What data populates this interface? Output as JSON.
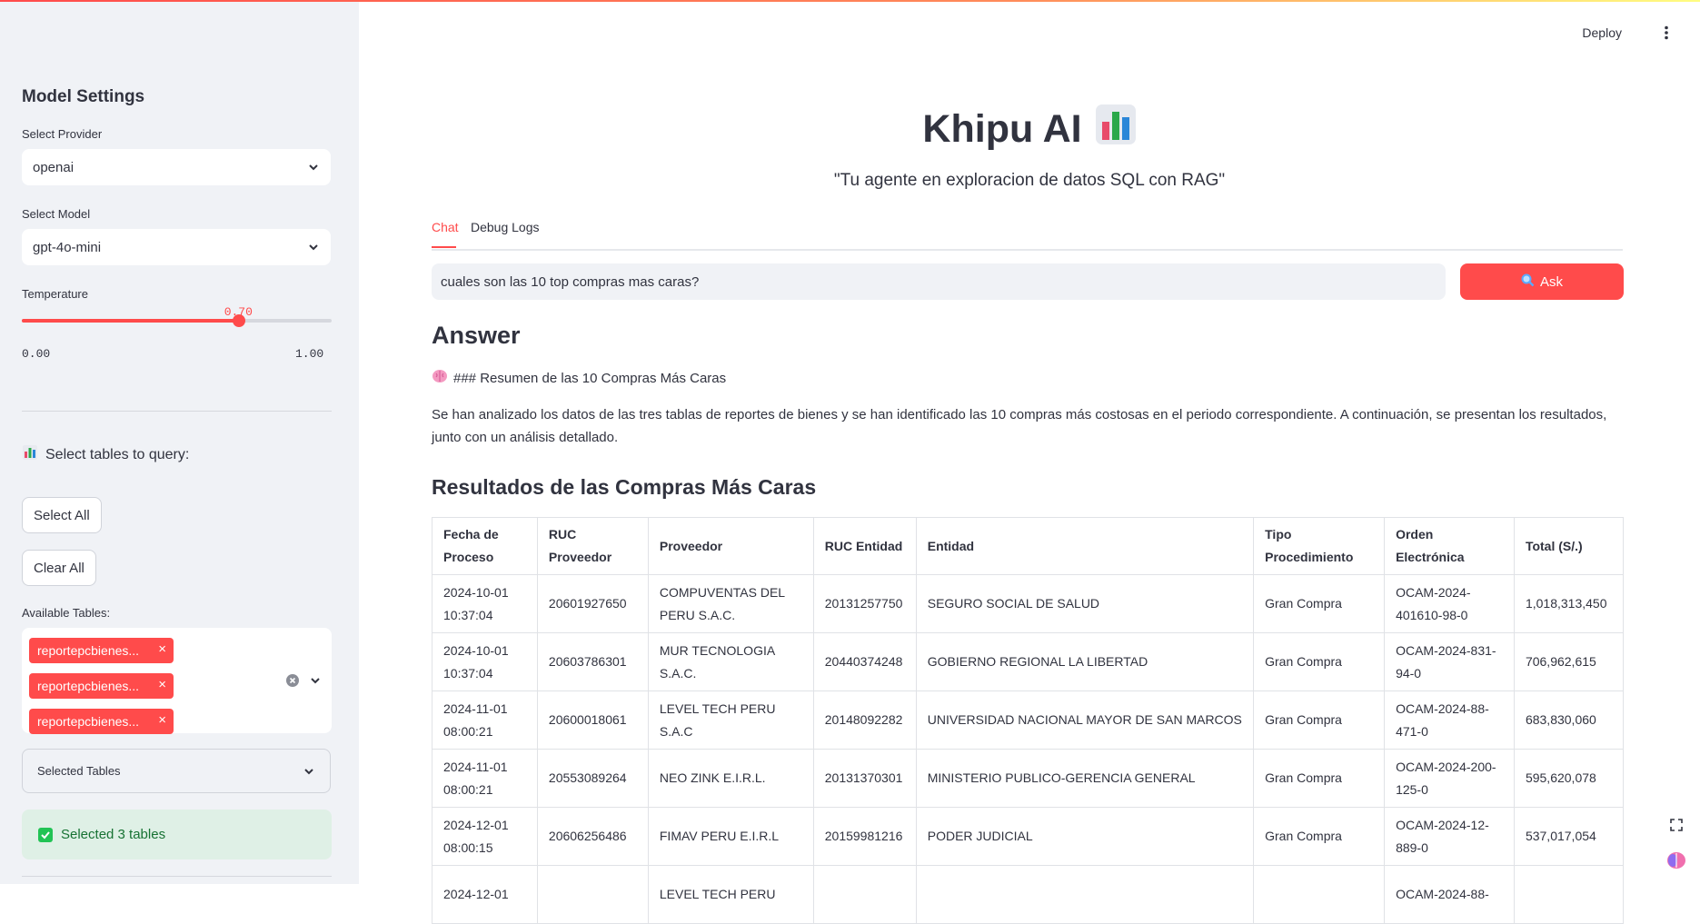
{
  "sidebar": {
    "title": "Model Settings",
    "provider": {
      "label": "Select Provider",
      "value": "openai"
    },
    "model": {
      "label": "Select Model",
      "value": "gpt-4o-mini"
    },
    "temperature": {
      "label": "Temperature",
      "value_text": "0.70",
      "value": 0.7,
      "min": "0.00",
      "max": "1.00"
    },
    "tables_heading": "Select tables to query:",
    "select_all_label": "Select All",
    "clear_all_label": "Clear All",
    "available_label": "Available Tables:",
    "chips": [
      "reportepcbienes...",
      "reportepcbienes...",
      "reportepcbienes..."
    ],
    "selected_tables_label": "Selected Tables",
    "success_text": "Selected 3 tables"
  },
  "header": {
    "deploy_label": "Deploy"
  },
  "main": {
    "title": "Khipu AI",
    "subtitle": "\"Tu agente en exploracion de datos SQL con RAG\"",
    "tabs": [
      {
        "label": "Chat"
      },
      {
        "label": "Debug Logs"
      }
    ],
    "query_value": "cuales son las 10 top compras mas caras?",
    "ask_label": "Ask",
    "answer_heading": "Answer",
    "summary_line": "### Resumen de las 10 Compras Más Caras",
    "paragraph": "Se han analizado los datos de las tres tablas de reportes de bienes y se han identificado las 10 compras más costosas en el periodo correspondiente. A continuación, se presentan los resultados, junto con un análisis detallado.",
    "results_heading": "Resultados de las Compras Más Caras"
  },
  "table": {
    "headers": [
      "Fecha de Proceso",
      "RUC Proveedor",
      "Proveedor",
      "RUC Entidad",
      "Entidad",
      "Tipo Procedimiento",
      "Orden Electrónica",
      "Total (S/.)"
    ],
    "rows": [
      [
        "2024-10-01 10:37:04",
        "20601927650",
        "COMPUVENTAS DEL PERU S.A.C.",
        "20131257750",
        "SEGURO SOCIAL DE SALUD",
        "Gran Compra",
        "OCAM-2024-401610-98-0",
        "1,018,313,450"
      ],
      [
        "2024-10-01 10:37:04",
        "20603786301",
        "MUR TECNOLOGIA S.A.C.",
        "20440374248",
        "GOBIERNO REGIONAL LA LIBERTAD",
        "Gran Compra",
        "OCAM-2024-831-94-0",
        "706,962,615"
      ],
      [
        "2024-11-01 08:00:21",
        "20600018061",
        "LEVEL TECH PERU S.A.C",
        "20148092282",
        "UNIVERSIDAD NACIONAL MAYOR DE SAN MARCOS",
        "Gran Compra",
        "OCAM-2024-88-471-0",
        "683,830,060"
      ],
      [
        "2024-11-01 08:00:21",
        "20553089264",
        "NEO ZINK E.I.R.L.",
        "20131370301",
        "MINISTERIO PUBLICO-GERENCIA GENERAL",
        "Gran Compra",
        "OCAM-2024-200-125-0",
        "595,620,078"
      ],
      [
        "2024-12-01 08:00:15",
        "20606256486",
        "FIMAV PERU E.I.R.L",
        "20159981216",
        "PODER JUDICIAL",
        "Gran Compra",
        "OCAM-2024-12-889-0",
        "537,017,054"
      ],
      [
        "2024-12-01",
        "",
        "LEVEL TECH PERU",
        "",
        "",
        "",
        "OCAM-2024-88-",
        ""
      ]
    ]
  }
}
